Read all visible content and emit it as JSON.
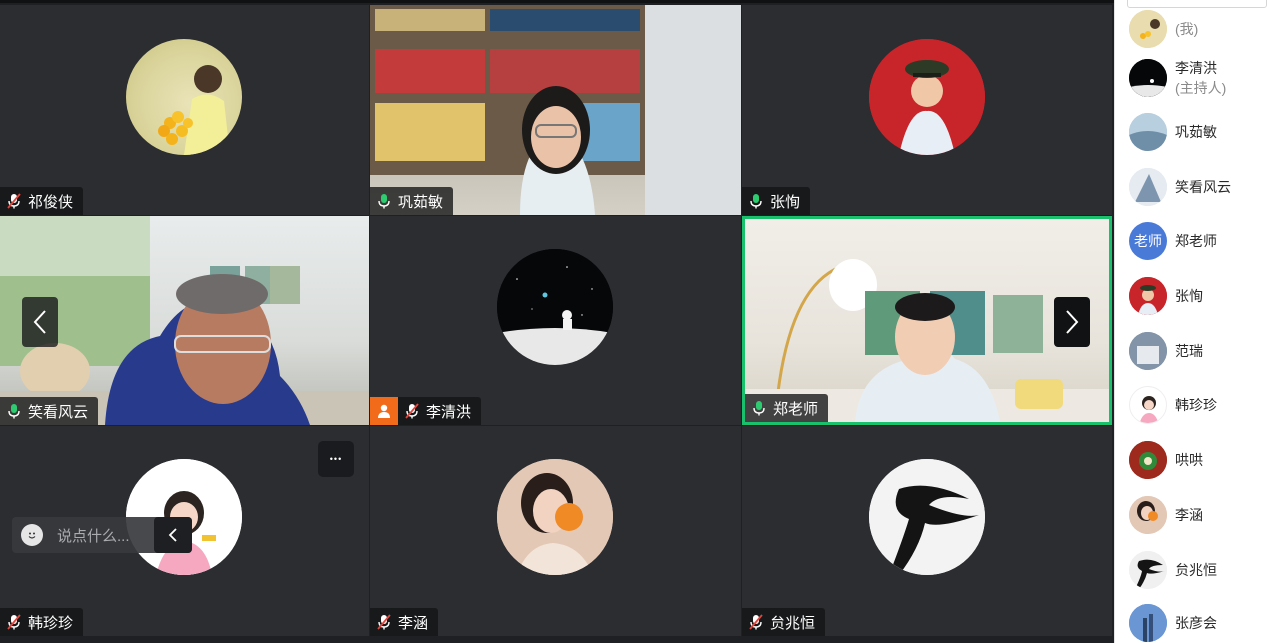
{
  "participants_grid": [
    {
      "name": "祁俊侠",
      "mic": "muted"
    },
    {
      "name": "巩茹敏",
      "mic": "on"
    },
    {
      "name": "张恂",
      "mic": "on"
    },
    {
      "name": "笑看风云",
      "mic": "on"
    },
    {
      "name": "李清洪",
      "mic": "muted",
      "host": true
    },
    {
      "name": "郑老师",
      "mic": "on",
      "speaking": true
    },
    {
      "name": "韩珍珍",
      "mic": "muted"
    },
    {
      "name": "李涵",
      "mic": "muted"
    },
    {
      "name": "贠兆恒",
      "mic": "muted"
    }
  ],
  "chat": {
    "placeholder": "说点什么..."
  },
  "more_label": "•••",
  "sidebar": {
    "items": [
      {
        "name": "",
        "sub": "(我)"
      },
      {
        "name": "李清洪",
        "sub": "(主持人)"
      },
      {
        "name": "巩茹敏"
      },
      {
        "name": "笑看风云"
      },
      {
        "name": "郑老师",
        "avatar_text": "老师"
      },
      {
        "name": "张恂"
      },
      {
        "name": "范瑞"
      },
      {
        "name": "韩珍珍"
      },
      {
        "name": "哄哄"
      },
      {
        "name": "李涵"
      },
      {
        "name": "贠兆恒"
      },
      {
        "name": "张彦会"
      }
    ]
  },
  "colors": {
    "active_border": "#19c16c",
    "host_badge": "#f26b1a",
    "mic_on": "#2ecc71",
    "mic_muted": "#ffffff",
    "teacher_avatar": "#4a7ad8"
  }
}
